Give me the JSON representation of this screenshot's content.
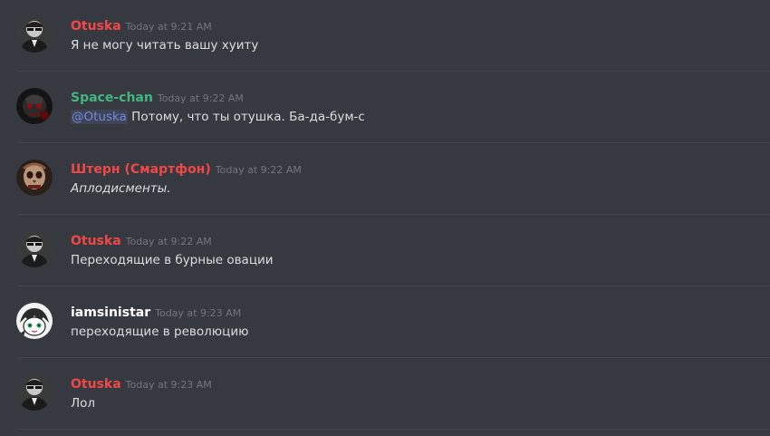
{
  "colors": {
    "background": "#36393f",
    "separator": "#40444b",
    "timestamp": "#72767d",
    "text": "#dcddde",
    "mention": "#7289da",
    "red_role": "#f04747",
    "green_role": "#43b581",
    "white_role": "#ffffff"
  },
  "messages": [
    {
      "username": "Otuska",
      "timestamp": "Today at 9:21 AM",
      "text": "Я не могу читать вашу хуиту",
      "avatar_icon": "sunglasses-man-avatar-icon",
      "name_color": "#f04747"
    },
    {
      "username": "Space-chan",
      "timestamp": "Today at 9:22 AM",
      "mention": "@Otuska",
      "text": " Потому, что ты отушка. Ба-да-бум-с",
      "avatar_icon": "dark-face-avatar-icon",
      "name_color": "#43b581"
    },
    {
      "username": "Штерн (Смартфон)",
      "timestamp": "Today at 9:22 AM",
      "text": "Аплодисменты.",
      "avatar_icon": "skull-face-avatar-icon",
      "name_color": "#f04747"
    },
    {
      "username": "Otuska",
      "timestamp": "Today at 9:22 AM",
      "text": "Переходящие в бурные овации",
      "avatar_icon": "sunglasses-man-avatar-icon",
      "name_color": "#f04747"
    },
    {
      "username": "iamsinistar",
      "timestamp": "Today at 9:23 AM",
      "text": "переходящие в революцию",
      "avatar_icon": "anime-character-avatar-icon",
      "name_color": "#ffffff"
    },
    {
      "username": "Otuska",
      "timestamp": "Today at 9:23 AM",
      "text": "Лол",
      "avatar_icon": "sunglasses-man-avatar-icon",
      "name_color": "#f04747"
    }
  ]
}
